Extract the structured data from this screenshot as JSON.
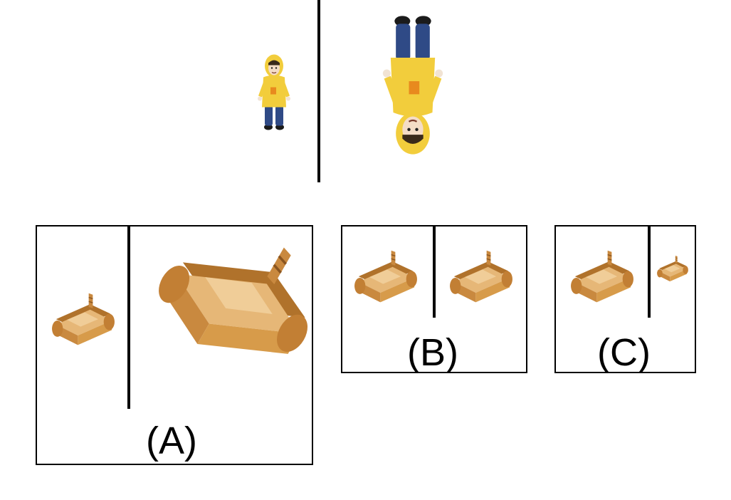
{
  "example": {
    "left_figure": "child-doll-upright",
    "right_figure": "child-doll-upside-down"
  },
  "options": [
    {
      "id": "A",
      "label": "(A)",
      "left_figure": "sofa-small",
      "right_figure": "sofa-large-rotated"
    },
    {
      "id": "B",
      "label": "(B)",
      "left_figure": "sofa-small",
      "right_figure": "sofa-small-same"
    },
    {
      "id": "C",
      "label": "(C)",
      "left_figure": "sofa-small",
      "right_figure": "sofa-tiny"
    }
  ],
  "colors": {
    "line": "#000000",
    "coat_yellow": "#f2cd3c",
    "jeans_blue": "#2f4a86",
    "sofa_wood": "#d79b4a",
    "sofa_dark": "#b0722b"
  }
}
